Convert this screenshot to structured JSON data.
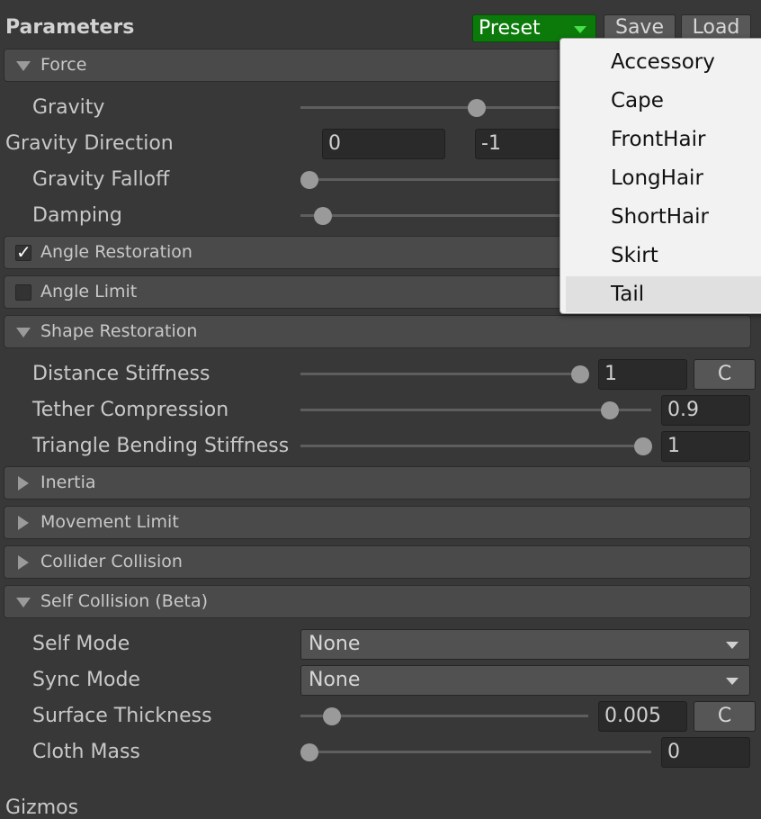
{
  "header": {
    "title": "Parameters",
    "preset_label": "Preset",
    "save_label": "Save",
    "load_label": "Load"
  },
  "sections": {
    "force": "Force",
    "angle_restoration": "Angle Restoration",
    "angle_limit": "Angle Limit",
    "shape_restoration": "Shape Restoration",
    "inertia": "Inertia",
    "movement_limit": "Movement Limit",
    "collider_collision": "Collider Collision",
    "self_collision": "Self Collision (Beta)"
  },
  "checkboxes": {
    "angle_restoration_checked": true,
    "angle_limit_checked": false,
    "check_glyph": "✓"
  },
  "force": {
    "gravity_label": "Gravity",
    "gravity_direction_label": "Gravity Direction",
    "gravity_direction_x": "0",
    "gravity_direction_y": "-1",
    "gravity_falloff_label": "Gravity Falloff",
    "damping_label": "Damping"
  },
  "shape_restoration": {
    "distance_stiffness_label": "Distance Stiffness",
    "distance_stiffness_value": "1",
    "tether_compression_label": "Tether Compression",
    "tether_compression_value": "0.9",
    "triangle_bending_label": "Triangle Bending Stiffness",
    "triangle_bending_value": "1",
    "curve_button": "C"
  },
  "self_collision": {
    "self_mode_label": "Self Mode",
    "self_mode_value": "None",
    "sync_mode_label": "Sync Mode",
    "sync_mode_value": "None",
    "surface_thickness_label": "Surface Thickness",
    "surface_thickness_value": "0.005",
    "cloth_mass_label": "Cloth Mass",
    "cloth_mass_value": "0",
    "curve_button": "C"
  },
  "footer": {
    "gizmos_label": "Gizmos"
  },
  "preset_menu": {
    "items": [
      "Accessory",
      "Cape",
      "FrontHair",
      "LongHair",
      "ShortHair",
      "Skirt",
      "Tail"
    ],
    "highlighted": "Tail"
  },
  "colors": {
    "background": "#383838",
    "section": "#4a4a4a",
    "preset_accent": "#0b7a0b",
    "menu_bg": "#f2f2f2"
  }
}
